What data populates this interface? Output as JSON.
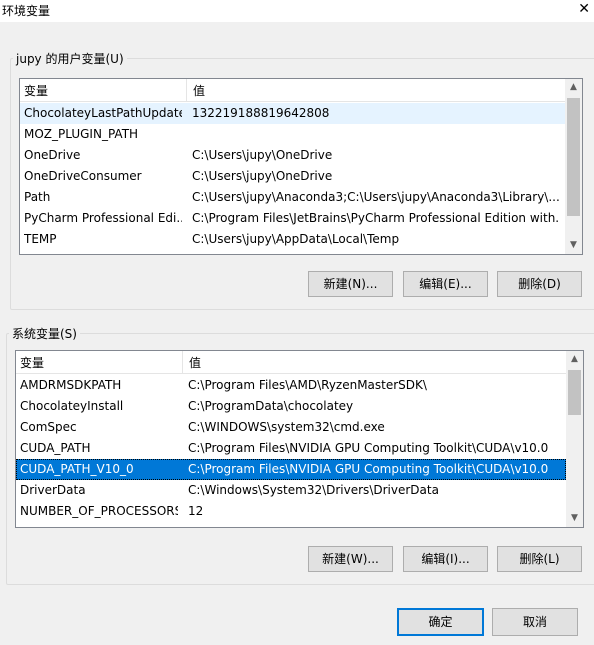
{
  "window": {
    "title": "环境变量",
    "close_glyph": "✕"
  },
  "user_vars": {
    "legend": "jupy 的用户变量(U)",
    "columns": [
      "变量",
      "值"
    ],
    "rows": [
      {
        "name": "ChocolateyLastPathUpdate",
        "value": "132219188819642808"
      },
      {
        "name": "MOZ_PLUGIN_PATH",
        "value": ""
      },
      {
        "name": "OneDrive",
        "value": "C:\\Users\\jupy\\OneDrive"
      },
      {
        "name": "OneDriveConsumer",
        "value": "C:\\Users\\jupy\\OneDrive"
      },
      {
        "name": "Path",
        "value": "C:\\Users\\jupy\\Anaconda3;C:\\Users\\jupy\\Anaconda3\\Library\\..."
      },
      {
        "name": "PyCharm Professional Edi...",
        "value": "C:\\Program Files\\JetBrains\\PyCharm Professional Edition with..."
      },
      {
        "name": "TEMP",
        "value": "C:\\Users\\jupy\\AppData\\Local\\Temp"
      }
    ],
    "buttons": {
      "new": "新建(N)...",
      "edit": "编辑(E)...",
      "delete": "删除(D)"
    }
  },
  "system_vars": {
    "legend": "系统变量(S)",
    "columns": [
      "变量",
      "值"
    ],
    "rows": [
      {
        "name": "AMDRMSDKPATH",
        "value": "C:\\Program Files\\AMD\\RyzenMasterSDK\\"
      },
      {
        "name": "ChocolateyInstall",
        "value": "C:\\ProgramData\\chocolatey"
      },
      {
        "name": "ComSpec",
        "value": "C:\\WINDOWS\\system32\\cmd.exe"
      },
      {
        "name": "CUDA_PATH",
        "value": "C:\\Program Files\\NVIDIA GPU Computing Toolkit\\CUDA\\v10.0"
      },
      {
        "name": "CUDA_PATH_V10_0",
        "value": "C:\\Program Files\\NVIDIA GPU Computing Toolkit\\CUDA\\v10.0"
      },
      {
        "name": "DriverData",
        "value": "C:\\Windows\\System32\\Drivers\\DriverData"
      },
      {
        "name": "NUMBER_OF_PROCESSORS",
        "value": "12"
      }
    ],
    "buttons": {
      "new": "新建(W)...",
      "edit": "编辑(I)...",
      "delete": "删除(L)"
    }
  },
  "footer": {
    "ok": "确定",
    "cancel": "取消"
  },
  "icons": {
    "scroll_up": "▲",
    "scroll_down": "▼"
  },
  "colors": {
    "selection": "#0078d7",
    "hover": "#e5f3ff",
    "primary_border": "#0078d7"
  }
}
